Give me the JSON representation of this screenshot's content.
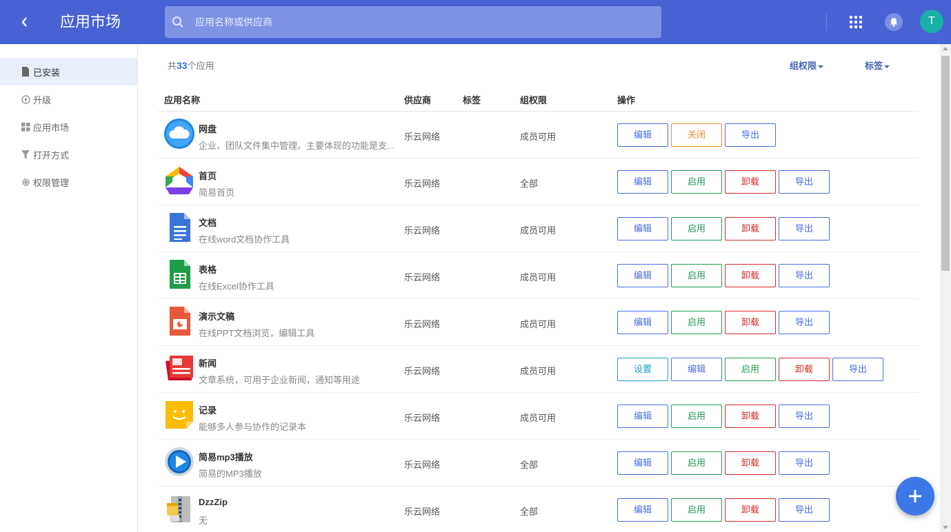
{
  "header": {
    "title": "应用市场",
    "search_placeholder": "应用名称或供应商",
    "avatar_letter": "T"
  },
  "sidebar": {
    "items": [
      {
        "label": "已安装",
        "icon": "file-icon",
        "active": true
      },
      {
        "label": "升级",
        "icon": "upgrade-circle-icon",
        "active": false
      },
      {
        "label": "应用市场",
        "icon": "grid-icon",
        "active": false
      },
      {
        "label": "打开方式",
        "icon": "filter-icon",
        "active": false
      },
      {
        "label": "权限管理",
        "icon": "gear-icon",
        "active": false
      }
    ]
  },
  "summary": {
    "prefix": "共",
    "count": "33",
    "suffix": "个应用"
  },
  "filters": {
    "group_perm": "组权限",
    "tags": "标签"
  },
  "table": {
    "headers": {
      "name": "应用名称",
      "vendor": "供应商",
      "tag": "标签",
      "perm": "组权限",
      "ops": "操作"
    },
    "rows": [
      {
        "name": "网盘",
        "desc": "企业、团队文件集中管理。主要体现的功能是支...",
        "vendor": "乐云网络",
        "perm": "成员可用",
        "icon": "cloud-icon",
        "actions": [
          {
            "label": "编辑",
            "kind": "blue"
          },
          {
            "label": "关闭",
            "kind": "orange"
          },
          {
            "label": "导出",
            "kind": "blue"
          }
        ]
      },
      {
        "name": "首页",
        "desc": "简易首页",
        "vendor": "乐云网络",
        "perm": "全部",
        "icon": "home-icon",
        "actions": [
          {
            "label": "编辑",
            "kind": "blue"
          },
          {
            "label": "启用",
            "kind": "green"
          },
          {
            "label": "卸载",
            "kind": "red"
          },
          {
            "label": "导出",
            "kind": "blue"
          }
        ]
      },
      {
        "name": "文档",
        "desc": "在线word文档协作工具",
        "vendor": "乐云网络",
        "perm": "成员可用",
        "icon": "doc-icon",
        "actions": [
          {
            "label": "编辑",
            "kind": "blue"
          },
          {
            "label": "启用",
            "kind": "green"
          },
          {
            "label": "卸载",
            "kind": "red"
          },
          {
            "label": "导出",
            "kind": "blue"
          }
        ]
      },
      {
        "name": "表格",
        "desc": "在线Excel协作工具",
        "vendor": "乐云网络",
        "perm": "成员可用",
        "icon": "sheet-icon",
        "actions": [
          {
            "label": "编辑",
            "kind": "blue"
          },
          {
            "label": "启用",
            "kind": "green"
          },
          {
            "label": "卸载",
            "kind": "red"
          },
          {
            "label": "导出",
            "kind": "blue"
          }
        ]
      },
      {
        "name": "演示文稿",
        "desc": "在线PPT文档浏览，编辑工具",
        "vendor": "乐云网络",
        "perm": "成员可用",
        "icon": "slides-icon",
        "actions": [
          {
            "label": "编辑",
            "kind": "blue"
          },
          {
            "label": "启用",
            "kind": "green"
          },
          {
            "label": "卸载",
            "kind": "red"
          },
          {
            "label": "导出",
            "kind": "blue"
          }
        ]
      },
      {
        "name": "新闻",
        "desc": "文章系统，可用于企业新闻，通知等用途",
        "vendor": "乐云网络",
        "perm": "成员可用",
        "icon": "news-icon",
        "actions": [
          {
            "label": "设置",
            "kind": "teal"
          },
          {
            "label": "编辑",
            "kind": "blue"
          },
          {
            "label": "启用",
            "kind": "green"
          },
          {
            "label": "卸载",
            "kind": "red"
          },
          {
            "label": "导出",
            "kind": "blue"
          }
        ]
      },
      {
        "name": "记录",
        "desc": "能够多人参与协作的记录本",
        "vendor": "乐云网络",
        "perm": "成员可用",
        "icon": "note-icon",
        "actions": [
          {
            "label": "编辑",
            "kind": "blue"
          },
          {
            "label": "启用",
            "kind": "green"
          },
          {
            "label": "卸载",
            "kind": "red"
          },
          {
            "label": "导出",
            "kind": "blue"
          }
        ]
      },
      {
        "name": "简易mp3播放",
        "desc": "简易的MP3播放",
        "vendor": "乐云网络",
        "perm": "全部",
        "icon": "play-icon",
        "actions": [
          {
            "label": "编辑",
            "kind": "blue"
          },
          {
            "label": "启用",
            "kind": "green"
          },
          {
            "label": "卸载",
            "kind": "red"
          },
          {
            "label": "导出",
            "kind": "blue"
          }
        ]
      },
      {
        "name": "DzzZip",
        "desc": "无",
        "vendor": "乐云网络",
        "perm": "全部",
        "icon": "zip-icon",
        "actions": [
          {
            "label": "编辑",
            "kind": "blue"
          },
          {
            "label": "启用",
            "kind": "green"
          },
          {
            "label": "卸载",
            "kind": "red"
          },
          {
            "label": "导出",
            "kind": "blue"
          }
        ]
      }
    ]
  },
  "fab": {
    "icon": "plus-icon"
  },
  "colors": {
    "header_bg": "#4662d3",
    "accent": "#3b6ee6",
    "sidebar_active_bg": "#e8eefa"
  }
}
